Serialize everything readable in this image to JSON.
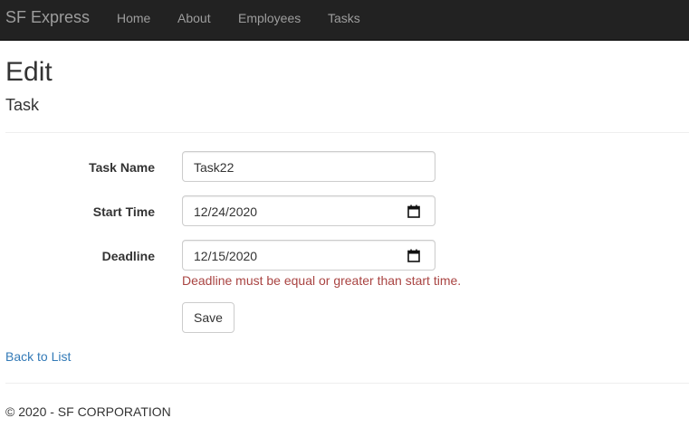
{
  "navbar": {
    "brand": "SF Express",
    "links": [
      "Home",
      "About",
      "Employees",
      "Tasks"
    ]
  },
  "page": {
    "title": "Edit",
    "subtitle": "Task"
  },
  "form": {
    "task_name": {
      "label": "Task Name",
      "value": "Task22"
    },
    "start_time": {
      "label": "Start Time",
      "value": "12/24/2020"
    },
    "deadline": {
      "label": "Deadline",
      "value": "12/15/2020",
      "error": "Deadline must be equal or greater than start time."
    },
    "save_label": "Save"
  },
  "back_link": "Back to List",
  "footer": "© 2020 - SF CORPORATION",
  "colors": {
    "navbar_bg": "#222222",
    "nav_text": "#9d9d9d",
    "error_text": "#a94442",
    "link": "#337ab7"
  },
  "icons": {
    "date_picker": "calendar-icon"
  }
}
